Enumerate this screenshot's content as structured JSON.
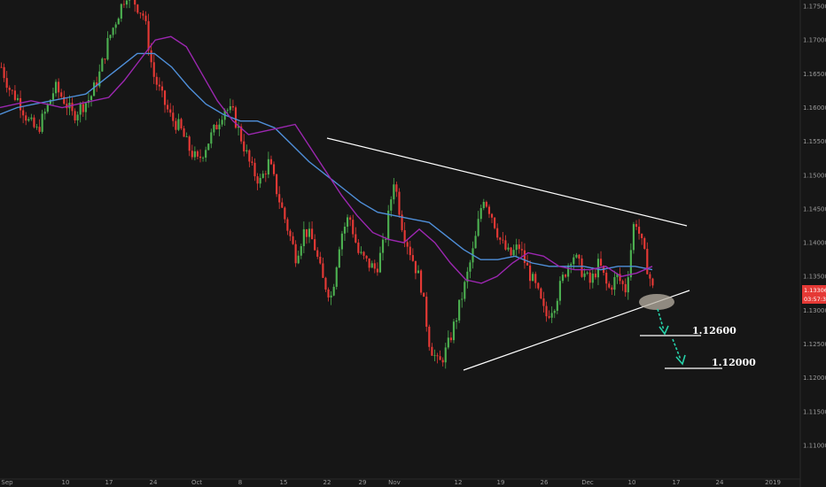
{
  "chart_data": {
    "type": "candlestick",
    "title": "",
    "xlabel": "",
    "ylabel": "",
    "ylim": [
      1.105,
      1.1775
    ],
    "grid": false,
    "y_ticks": [
      "1.17500",
      "1.17000",
      "1.16500",
      "1.16000",
      "1.15500",
      "1.15000",
      "1.14500",
      "1.14000",
      "1.13500",
      "1.13000",
      "1.12500",
      "1.12000",
      "1.11500",
      "1.11000"
    ],
    "x_ticks": [
      "Sep",
      "10",
      "17",
      "24",
      "Oct",
      "8",
      "15",
      "22",
      "29",
      "Nov",
      "12",
      "19",
      "26",
      "Dec",
      "10",
      "17",
      "24",
      "2019"
    ],
    "last_price": "1.13306",
    "countdown": "03:57:37",
    "close_series": [
      1.166,
      1.1625,
      1.161,
      1.158,
      1.1565,
      1.1595,
      1.163,
      1.1612,
      1.1588,
      1.1602,
      1.1615,
      1.165,
      1.17,
      1.1735,
      1.177,
      1.1755,
      1.1735,
      1.165,
      1.1615,
      1.1585,
      1.157,
      1.154,
      1.152,
      1.1545,
      1.157,
      1.16,
      1.159,
      1.155,
      1.151,
      1.149,
      1.152,
      1.147,
      1.1425,
      1.138,
      1.142,
      1.14,
      1.1345,
      1.132,
      1.141,
      1.144,
      1.1385,
      1.137,
      1.136,
      1.1405,
      1.1495,
      1.142,
      1.138,
      1.134,
      1.125,
      1.1218,
      1.1245,
      1.129,
      1.134,
      1.1395,
      1.147,
      1.144,
      1.14,
      1.138,
      1.1395,
      1.136,
      1.133,
      1.129,
      1.131,
      1.135,
      1.1385,
      1.136,
      1.134,
      1.137,
      1.133,
      1.135,
      1.133,
      1.144,
      1.1385,
      1.1331
    ],
    "ma_fast": [
      1.16,
      1.1605,
      1.161,
      1.1605,
      1.16,
      1.1605,
      1.161,
      1.1615,
      1.164,
      1.167,
      1.17,
      1.1705,
      1.169,
      1.165,
      1.161,
      1.158,
      1.156,
      1.1565,
      1.157,
      1.1575,
      1.154,
      1.1505,
      1.147,
      1.144,
      1.1415,
      1.1405,
      1.14,
      1.142,
      1.14,
      1.137,
      1.1345,
      1.134,
      1.135,
      1.137,
      1.1385,
      1.138,
      1.1365,
      1.136,
      1.136,
      1.1365,
      1.135,
      1.1355,
      1.1365
    ],
    "ma_slow": [
      1.159,
      1.16,
      1.1605,
      1.161,
      1.1615,
      1.162,
      1.164,
      1.166,
      1.168,
      1.168,
      1.166,
      1.163,
      1.1605,
      1.159,
      1.158,
      1.158,
      1.157,
      1.1545,
      1.152,
      1.15,
      1.148,
      1.146,
      1.1445,
      1.144,
      1.1435,
      1.143,
      1.141,
      1.139,
      1.1375,
      1.1375,
      1.138,
      1.137,
      1.1365,
      1.1365,
      1.1365,
      1.136,
      1.1365,
      1.1365,
      1.136
    ],
    "trendlines": [
      {
        "name": "upper",
        "from": [
          1.1559
        ],
        "to": [
          1.1427
        ]
      },
      {
        "name": "lower",
        "from": [
          1.1216
        ],
        "to": [
          1.1319
        ]
      }
    ],
    "targets": [
      {
        "label": "1.12600",
        "value": 1.126
      },
      {
        "label": "1.12000",
        "value": 1.12
      }
    ],
    "colors": {
      "background": "#161616",
      "up": "#4caf50",
      "down": "#e53935",
      "ma_fast": "#9c27b0",
      "ma_slow": "#4f8fd9",
      "trendline": "#ffffff",
      "arrow": "#26d0a8",
      "highlight": "#b9b2a4",
      "badge": "#e53935"
    }
  }
}
